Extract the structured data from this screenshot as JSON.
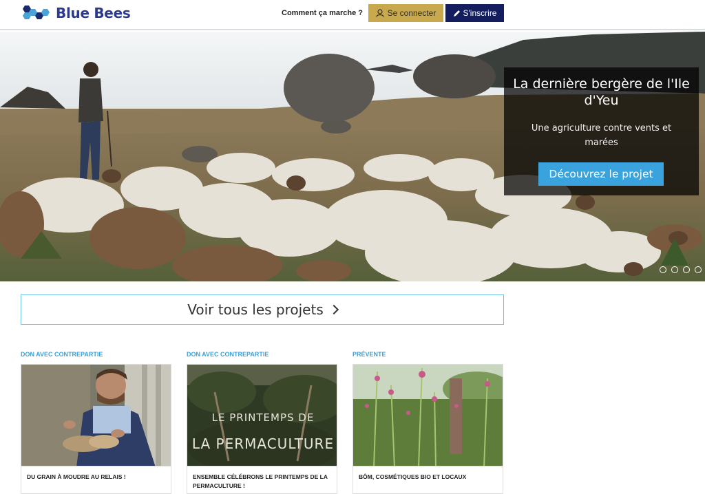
{
  "header": {
    "logo_text": "Blue Bees",
    "how_it_works": "Comment ça marche ?",
    "login_label": "Se connecter",
    "signup_label": "S'inscrire",
    "colors": {
      "brand": "#2b3a8c",
      "login_bg": "#c9a94e",
      "signup_bg": "#141d5e"
    }
  },
  "hero": {
    "title": "La dernière bergère de l'Ile d'Yeu",
    "subtitle": "Une agriculture contre vents et marées",
    "cta_label": "Découvrez le projet",
    "slide_count": 4,
    "colors": {
      "cta_bg": "#3aa2dc"
    }
  },
  "see_all": {
    "label": "Voir tous les projets"
  },
  "projects": [
    {
      "category": "DON AVEC CONTREPARTIE",
      "title": "DU GRAIN À MOUDRE AU RELAIS !",
      "image": "man-with-seeds-photo"
    },
    {
      "category": "DON AVEC CONTREPARTIE",
      "title": "ENSEMBLE CÉLÉBRONS LE PRINTEMPS DE LA PERMACULTURE !",
      "image": "permaculture-garden-photo",
      "image_caption_line1": "LE PRINTEMPS DE",
      "image_caption_line2": "LA PERMACULTURE"
    },
    {
      "category": "PRÉVENTE",
      "title": "BÔM, COSMÉTIQUES BIO ET LOCAUX",
      "image": "wildflowers-field-photo"
    }
  ]
}
